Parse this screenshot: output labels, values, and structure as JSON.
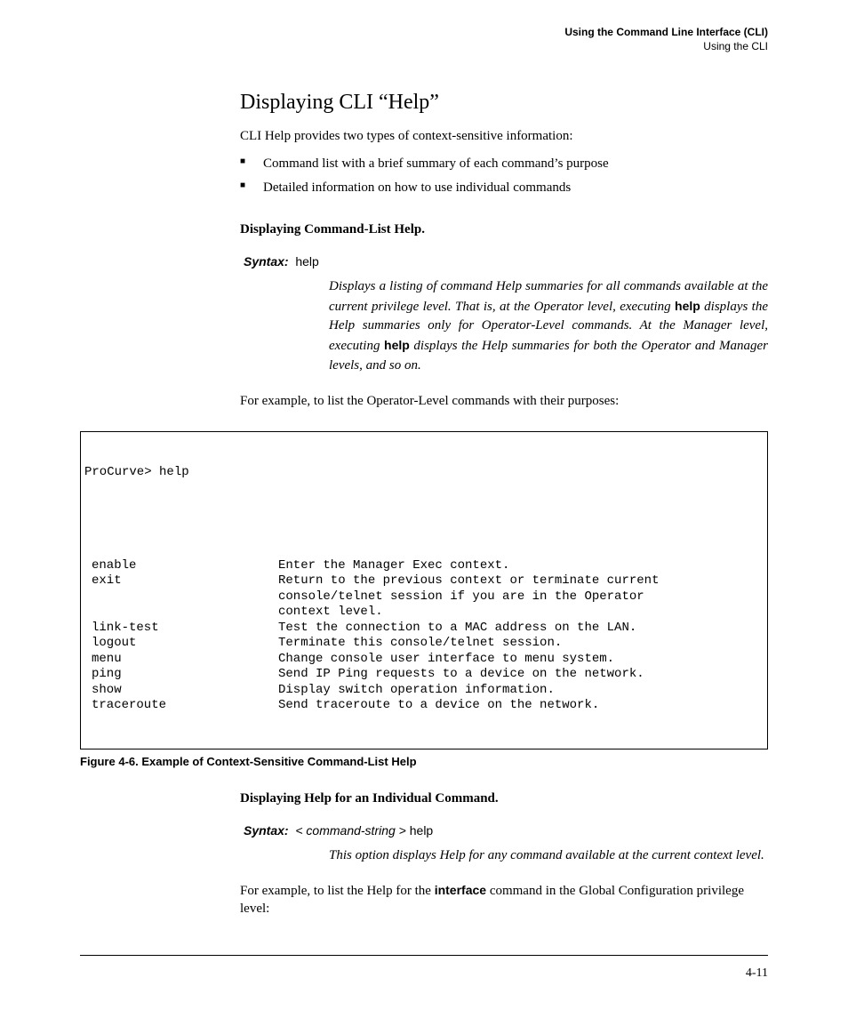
{
  "runningHead": {
    "line1": "Using the Command Line Interface (CLI)",
    "line2": "Using the CLI"
  },
  "title": "Displaying CLI “Help”",
  "intro": "CLI Help provides two types of context-sensitive information:",
  "bullets": [
    "Command list with a brief summary of each command’s purpose",
    "Detailed information on how to use individual commands"
  ],
  "sub1": "Displaying Command-List Help.",
  "syntax1": {
    "label": "Syntax:",
    "value": "help"
  },
  "desc1": {
    "pre": "Displays a listing of command Help summaries for all commands available at the current privilege level. That is,  at the Operator level, executing ",
    "kw1": "help",
    "mid": " displays the Help summaries only for Operator-Level commands. At the Manager level, executing ",
    "kw2": "help",
    "post": " displays the Help summaries for both the Operator and Manager levels, and so on."
  },
  "example1": "For example, to list the Operator-Level commands with their purposes:",
  "terminal": {
    "prompt": "ProCurve> help",
    "rows": [
      {
        "cmd": "enable",
        "desc": "Enter the Manager Exec context."
      },
      {
        "cmd": "exit",
        "desc": "Return to the previous context or terminate current"
      },
      {
        "cmd": "",
        "desc": "console/telnet session if you are in the Operator"
      },
      {
        "cmd": "",
        "desc": "context level."
      },
      {
        "cmd": "link-test",
        "desc": "Test the connection to a MAC address on the LAN."
      },
      {
        "cmd": "logout",
        "desc": "Terminate this console/telnet session."
      },
      {
        "cmd": "menu",
        "desc": "Change console user interface to menu system."
      },
      {
        "cmd": "ping",
        "desc": "Send IP Ping requests to a device on the network."
      },
      {
        "cmd": "show",
        "desc": "Display switch operation information."
      },
      {
        "cmd": "traceroute",
        "desc": "Send traceroute to a device on the network."
      }
    ]
  },
  "figCaption": "Figure 4-6.   Example of Context-Sensitive Command-List Help",
  "sub2": "Displaying Help for an Individual Command.",
  "syntax2": {
    "label": "Syntax:",
    "arg": "< command-string >",
    "value": "help"
  },
  "desc2": "This option displays Help for any command  available at the current context level.",
  "example2": {
    "pre": "For example, to list the Help for the ",
    "kw": "interface",
    "post": " command in the Global Configuration privilege level:"
  },
  "pageNum": "4-11"
}
